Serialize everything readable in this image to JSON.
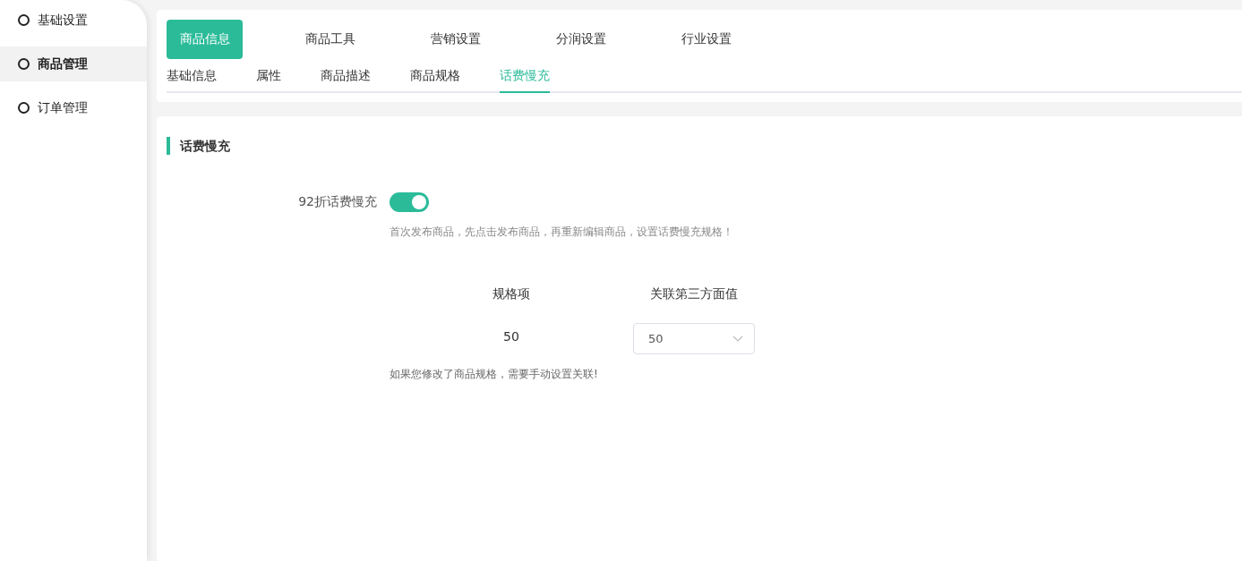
{
  "sidebar": {
    "items": [
      {
        "label": "基础设置",
        "selected": false
      },
      {
        "label": "商品管理",
        "selected": true
      },
      {
        "label": "订单管理",
        "selected": false
      }
    ]
  },
  "tabs": [
    {
      "label": "商品信息",
      "selected": true
    },
    {
      "label": "商品工具",
      "selected": false
    },
    {
      "label": "营销设置",
      "selected": false
    },
    {
      "label": "分润设置",
      "selected": false
    },
    {
      "label": "行业设置",
      "selected": false
    }
  ],
  "subtabs": [
    {
      "label": "基础信息",
      "selected": false
    },
    {
      "label": "属性",
      "selected": false
    },
    {
      "label": "商品描述",
      "selected": false
    },
    {
      "label": "商品规格",
      "selected": false
    },
    {
      "label": "话费慢充",
      "selected": true
    }
  ],
  "section": {
    "title": "话费慢充",
    "toggle": {
      "label": "92折话费慢充",
      "on": true
    },
    "hint": "首次发布商品，先点击发布商品，再重新编辑商品，设置话费慢充规格！",
    "table": {
      "columns": [
        "规格项",
        "关联第三方面值"
      ],
      "rows": [
        {
          "spec": "50",
          "value": "50"
        }
      ]
    },
    "note": "如果您修改了商品规格，需要手动设置关联!"
  }
}
